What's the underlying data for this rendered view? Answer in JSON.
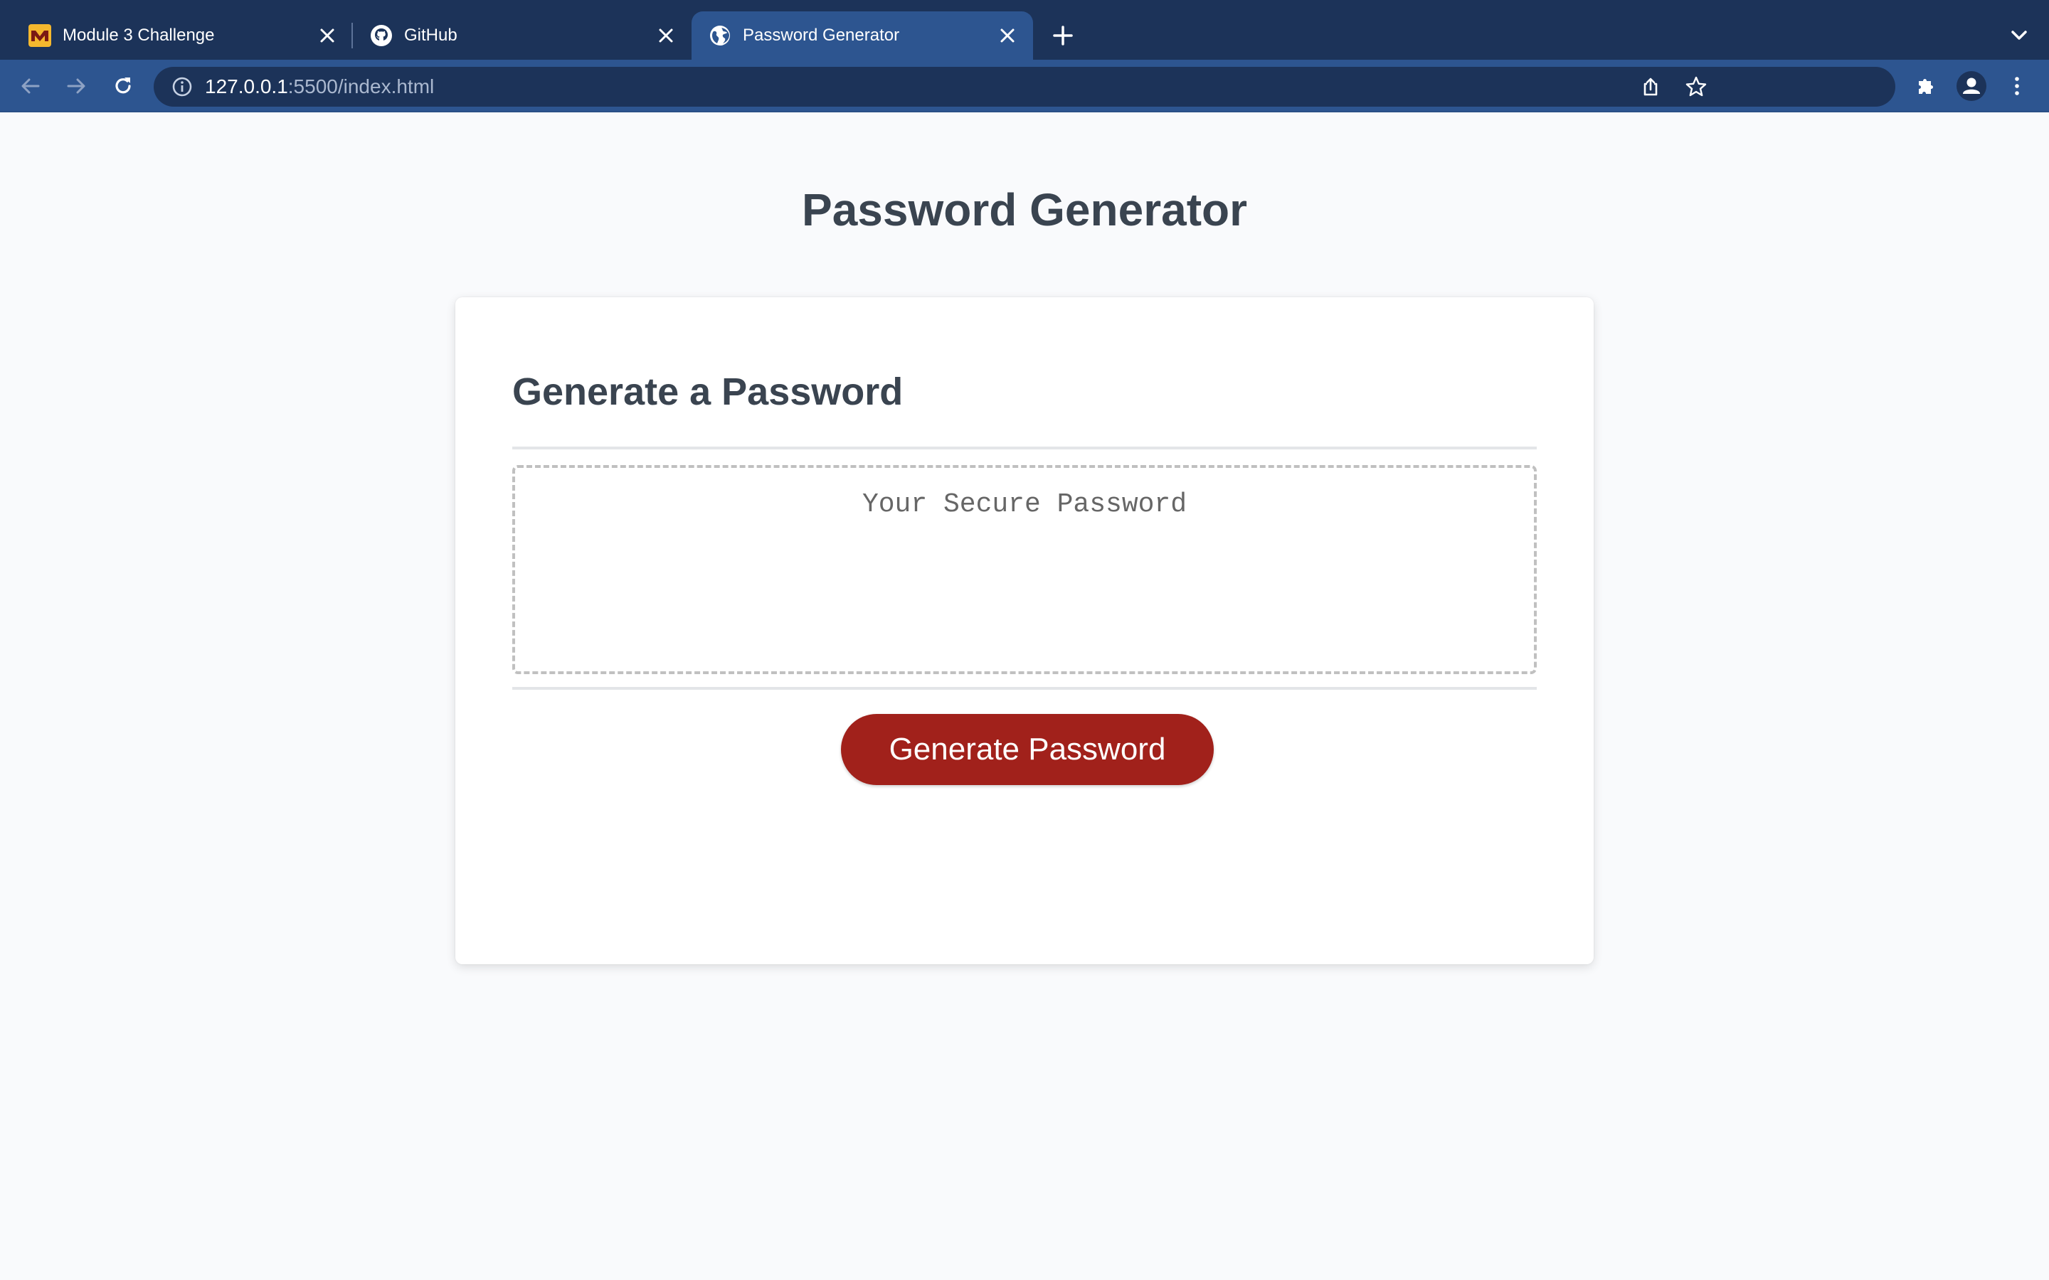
{
  "browser": {
    "tabs": [
      {
        "title": "Module 3 Challenge",
        "icon": "module-logo-icon",
        "active": false
      },
      {
        "title": "GitHub",
        "icon": "github-icon",
        "active": false
      },
      {
        "title": "Password Generator",
        "icon": "globe-icon",
        "active": true
      }
    ],
    "url": {
      "host": "127.0.0.1",
      "rest": ":5500/index.html"
    },
    "colors": {
      "tabstrip": "#1c3359",
      "toolbar": "#2d5590",
      "omnibox": "#1c3359"
    }
  },
  "page": {
    "title": "Password Generator",
    "card": {
      "header": "Generate a Password",
      "password_placeholder": "Your Secure Password",
      "password_value": "",
      "button_label": "Generate Password"
    },
    "colors": {
      "button": "#a1211b",
      "heading": "#3a4450",
      "background": "#f9fafc"
    }
  }
}
